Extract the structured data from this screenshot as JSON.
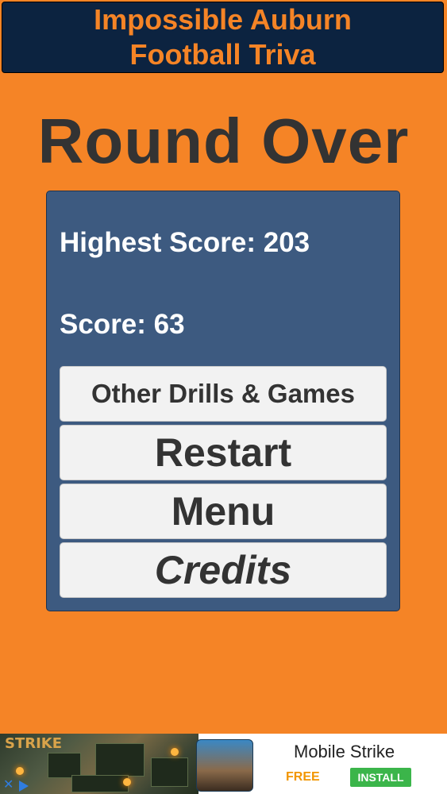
{
  "header": {
    "line1": "Impossible Auburn",
    "line2": "Football Triva"
  },
  "heading": "Round Over",
  "scores": {
    "highest": "Highest Score: 203",
    "current": "Score: 63"
  },
  "buttons": {
    "other": "Other Drills & Games",
    "restart": "Restart",
    "menu": "Menu",
    "credits": "Credits"
  },
  "ad": {
    "art_text": "STRIKE",
    "app_name": "Mobile Strike",
    "free": "FREE",
    "install": "INSTALL"
  },
  "colors": {
    "background": "#f58426",
    "header": "#0c2340",
    "panel": "#3d5a80"
  }
}
